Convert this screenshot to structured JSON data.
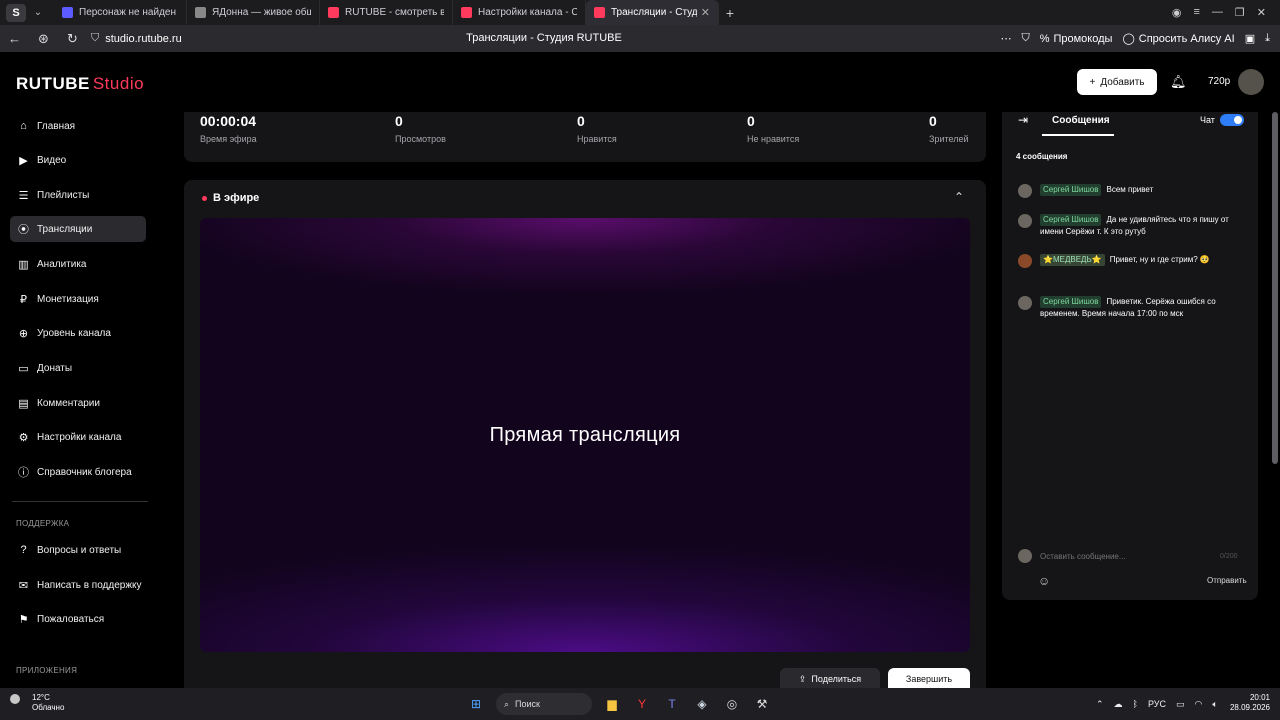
{
  "browser": {
    "tabs": [
      {
        "label": "Персонаж не найден | W",
        "color": "#5b5bff"
      },
      {
        "label": "ЯДонна — живое общ",
        "color": "#ffffff"
      },
      {
        "label": "RUTUBE - смотреть виде",
        "color": "#ff3a5c"
      },
      {
        "label": "Настройки канала - Студ",
        "color": "#ff3a5c"
      },
      {
        "label": "Трансляции - Студия R",
        "color": "#ff3a5c"
      }
    ],
    "url": "studio.rutube.ru",
    "page_title": "Трансляции - Студия RUTUBE",
    "promo_label": "Промокоды",
    "alice_label": "Спросить Алису AI"
  },
  "header": {
    "logo_main": "RUTUBE",
    "logo_studio": "Studio",
    "add_label": "Добавить",
    "quality": "720p"
  },
  "sidebar": {
    "items": [
      {
        "label": "Главная",
        "icon": "home-icon"
      },
      {
        "label": "Видео",
        "icon": "video-icon"
      },
      {
        "label": "Плейлисты",
        "icon": "playlist-icon"
      },
      {
        "label": "Трансляции",
        "icon": "broadcast-icon"
      },
      {
        "label": "Аналитика",
        "icon": "analytics-icon"
      },
      {
        "label": "Монетизация",
        "icon": "money-icon"
      },
      {
        "label": "Уровень канала",
        "icon": "level-icon"
      },
      {
        "label": "Донаты",
        "icon": "donate-icon"
      },
      {
        "label": "Комментарии",
        "icon": "comments-icon"
      },
      {
        "label": "Настройки канала",
        "icon": "gear-icon"
      },
      {
        "label": "Справочник блогера",
        "icon": "guide-icon"
      }
    ],
    "support_title": "ПОДДЕРЖКА",
    "support_items": [
      {
        "label": "Вопросы и ответы",
        "icon": "faq-icon"
      },
      {
        "label": "Написать в поддержку",
        "icon": "support-icon"
      },
      {
        "label": "Пожаловаться",
        "icon": "report-icon"
      }
    ],
    "apps_title": "ПРИЛОЖЕНИЯ"
  },
  "stats": [
    {
      "value": "00:00:04",
      "label": "Время эфира"
    },
    {
      "value": "0",
      "label": "Просмотров"
    },
    {
      "value": "0",
      "label": "Нравится"
    },
    {
      "value": "0",
      "label": "Не нравится"
    },
    {
      "value": "0",
      "label": "Зрителей"
    }
  ],
  "live": {
    "title": "В эфире",
    "player_text": "Прямая трансляция",
    "share_label": "Поделиться",
    "end_label": "Завершить"
  },
  "chat": {
    "tab_label": "Сообщения",
    "chat_label": "Чат",
    "count": "4 сообщения",
    "messages": [
      {
        "author": "Сергей Шишов",
        "text": "Всем привет"
      },
      {
        "author": "Сергей Шишов",
        "text": "Да не удивляйтесь что я пишу от имени Серёжи т. К это рутуб"
      },
      {
        "author": "⭐МЕДВЕДЬ⭐",
        "text": "Привет, ну и где стрим? 🥺"
      },
      {
        "author": "Сергей Шишов",
        "text": "Приветик. Серёжа ошибся со временем. Время начала 17:00 по мск"
      }
    ],
    "input_placeholder": "Оставить сообщение...",
    "counter": "0/200",
    "send_label": "Отправить"
  },
  "taskbar": {
    "temp": "12°C",
    "weather": "Облачно",
    "search_label": "Поиск",
    "lang": "РУС",
    "time": "20:01",
    "date": "28.09.2026"
  }
}
